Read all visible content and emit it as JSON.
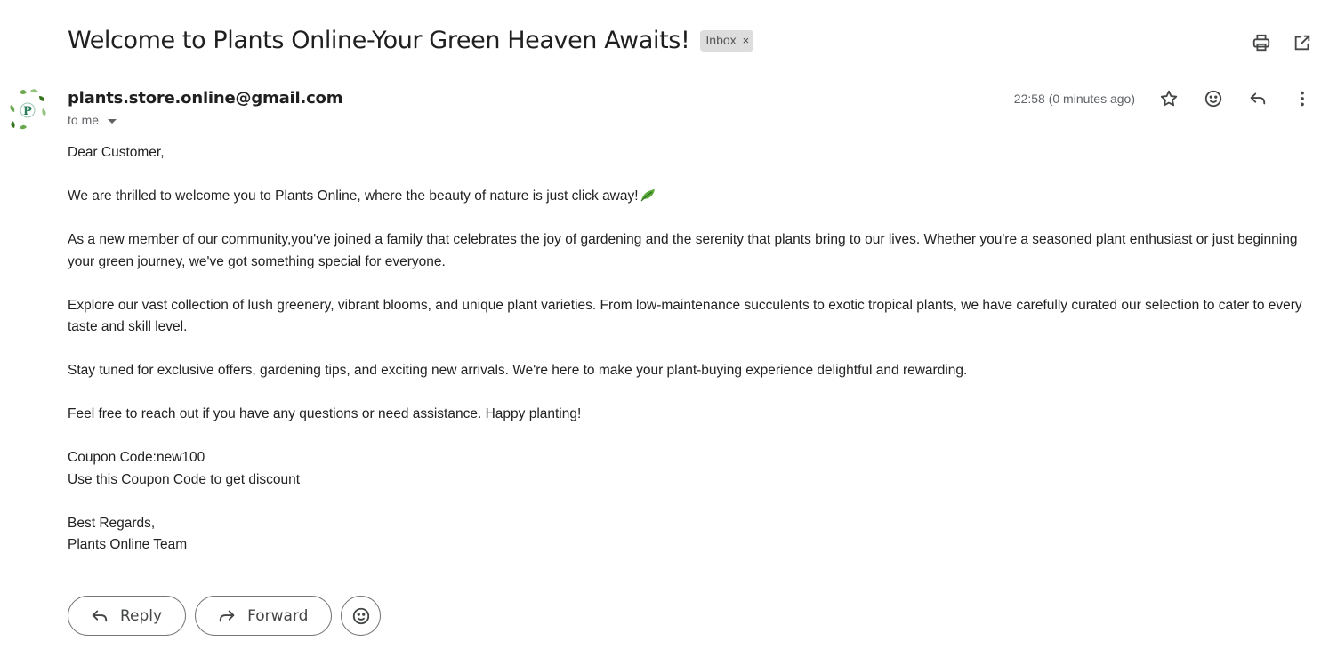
{
  "email": {
    "subject": "Welcome to Plants Online-Your Green Heaven Awaits!",
    "label": "Inbox",
    "label_remove": "×",
    "sender": "plants.store.online@gmail.com",
    "recipient_label": "to me",
    "timestamp": "22:58 (0 minutes ago)",
    "body": {
      "greeting": "Dear Customer,",
      "p1": "We are thrilled to welcome you to Plants Online, where the beauty of nature is just click away!",
      "p2": "As a new member of our community,you've joined a family that celebrates the joy of gardening and the serenity that plants bring to our lives. Whether you're a seasoned plant enthusiast or just beginning your green journey, we've got something special for everyone.",
      "p3": "Explore our vast collection of lush greenery, vibrant blooms, and unique plant varieties. From low-maintenance succulents to exotic tropical plants, we have carefully curated our selection to cater to every taste and skill level.",
      "p4": "Stay tuned for exclusive offers, gardening tips, and exciting new arrivals. We're here to make your plant-buying experience delightful and rewarding.",
      "p5": "Feel free to reach out if you have any questions or need assistance. Happy planting!",
      "coupon_line": "Coupon Code:new100",
      "coupon_hint": "Use this Coupon Code to get discount",
      "signoff": "Best Regards,",
      "signature": "Plants Online Team"
    }
  },
  "actions": {
    "reply_label": "Reply",
    "forward_label": "Forward"
  },
  "icons": {
    "print": "print-icon",
    "open_new_window": "open-in-new-icon",
    "star": "star-icon",
    "emoji": "emoji-icon",
    "reply": "reply-icon",
    "more": "more-vert-icon",
    "leaf_emoji": "leaf-emoji-icon"
  },
  "colors": {
    "text": "#202124",
    "muted": "#5f6368",
    "chip_bg": "#dddddd",
    "leaf_green": "#3a9a2f"
  }
}
